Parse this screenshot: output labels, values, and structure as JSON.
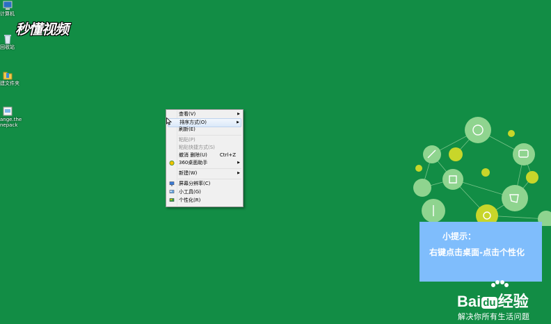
{
  "desktop_icons": [
    {
      "name": "computer",
      "label": "计算机"
    },
    {
      "name": "recycle-bin",
      "label": "回收站"
    },
    {
      "name": "new-folder",
      "label": "建文件夹"
    },
    {
      "name": "theme-file",
      "label": "ange.the\nnepack"
    }
  ],
  "watermark": "秒懂视频",
  "context_menu": {
    "items": [
      {
        "label": "查看(V)",
        "submenu": true,
        "disabled": false
      },
      {
        "label": "排序方式(O)",
        "submenu": true,
        "disabled": false,
        "highlighted": true
      },
      {
        "label": "刷新(E)",
        "submenu": false,
        "disabled": false
      },
      {
        "label": "粘贴(P)",
        "submenu": false,
        "disabled": true
      },
      {
        "label": "粘贴快捷方式(S)",
        "submenu": false,
        "disabled": true
      },
      {
        "label": "撤消 删除(U)",
        "shortcut": "Ctrl+Z",
        "submenu": false,
        "disabled": false
      },
      {
        "label": "360桌面助手",
        "submenu": true,
        "disabled": false,
        "icon": "360-icon"
      },
      {
        "label": "新建(W)",
        "submenu": true,
        "disabled": false
      },
      {
        "label": "屏幕分辨率(C)",
        "submenu": false,
        "disabled": false,
        "icon": "monitor-icon"
      },
      {
        "label": "小工具(G)",
        "submenu": false,
        "disabled": false,
        "icon": "gadgets-icon"
      },
      {
        "label": "个性化(R)",
        "submenu": false,
        "disabled": false,
        "icon": "personalize-icon"
      }
    ]
  },
  "tip": {
    "title": "小提示：",
    "text": "右键点击桌面-点击个性化"
  },
  "baidu": {
    "logo_prefix": "Bai",
    "logo_du": "du",
    "logo_suffix": "经验",
    "slogan": "解决你所有生活问题"
  },
  "colors": {
    "desktop": "#128d45",
    "tip_box": "#7fbdfc",
    "decor_light_green": "#8fd48f",
    "decor_yellow": "#c8d62a"
  }
}
